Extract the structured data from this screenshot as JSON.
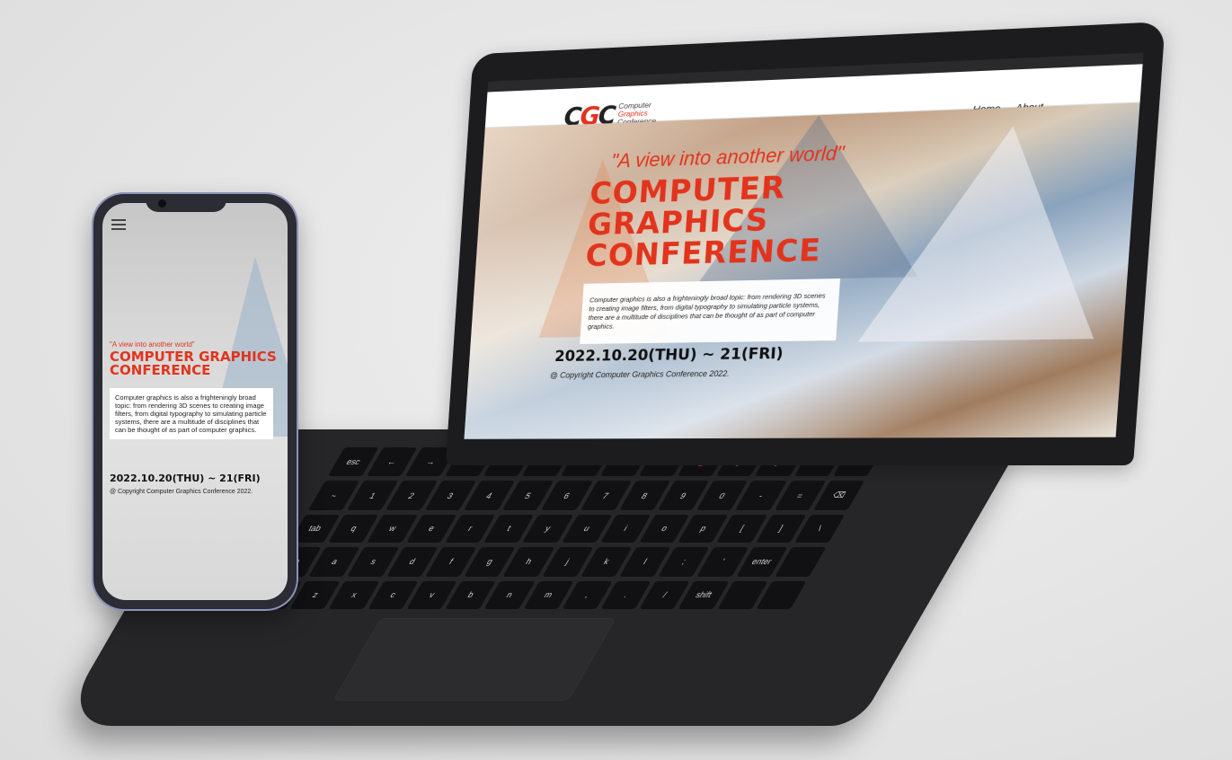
{
  "colors": {
    "accent": "#e2341d",
    "background": "#e6e6e6",
    "device": "#1c1c1e"
  },
  "site": {
    "logo_mark": [
      "C",
      "G",
      "C"
    ],
    "logo_text": [
      "Computer",
      "Graphics",
      "Conference"
    ],
    "nav": [
      "Home",
      "About"
    ],
    "social_icons": [
      "facebook-icon",
      "twitter-icon"
    ],
    "quote": "\"A view into another world\"",
    "title_lines": [
      "COMPUTER",
      "GRAPHICS",
      "CONFERENCE"
    ],
    "description": "Computer graphics is also a frighteningly broad topic: from rendering 3D scenes to creating image filters, from digital typography to simulating particle systems, there are a multitude of disciplines that can be thought of as part of computer graphics.",
    "date": "2022.10.20(THU) ~ 21(FRI)",
    "copyright": "@ Copyright Computer Graphics Conference 2022."
  },
  "phone": {
    "menu_icon": "hamburger-icon",
    "title": "COMPUTER GRAPHICS CONFERENCE"
  },
  "keyboard": {
    "keys": [
      "esc",
      "←",
      "→",
      "⟳",
      "⛶",
      "▭",
      "☼",
      "☀",
      "⏯",
      "🔇",
      "🔉",
      "🔊",
      "⏻",
      "",
      "~",
      "1",
      "2",
      "3",
      "4",
      "5",
      "6",
      "7",
      "8",
      "9",
      "0",
      "-",
      "=",
      "⌫",
      "tab",
      "q",
      "w",
      "e",
      "r",
      "t",
      "y",
      "u",
      "i",
      "o",
      "p",
      "[",
      "]",
      "\\",
      "◉",
      "a",
      "s",
      "d",
      "f",
      "g",
      "h",
      "j",
      "k",
      "l",
      ";",
      "'",
      "enter",
      "",
      "shift",
      "z",
      "x",
      "c",
      "v",
      "b",
      "n",
      "m",
      ",",
      ".",
      "/",
      "shift",
      "",
      ""
    ]
  }
}
